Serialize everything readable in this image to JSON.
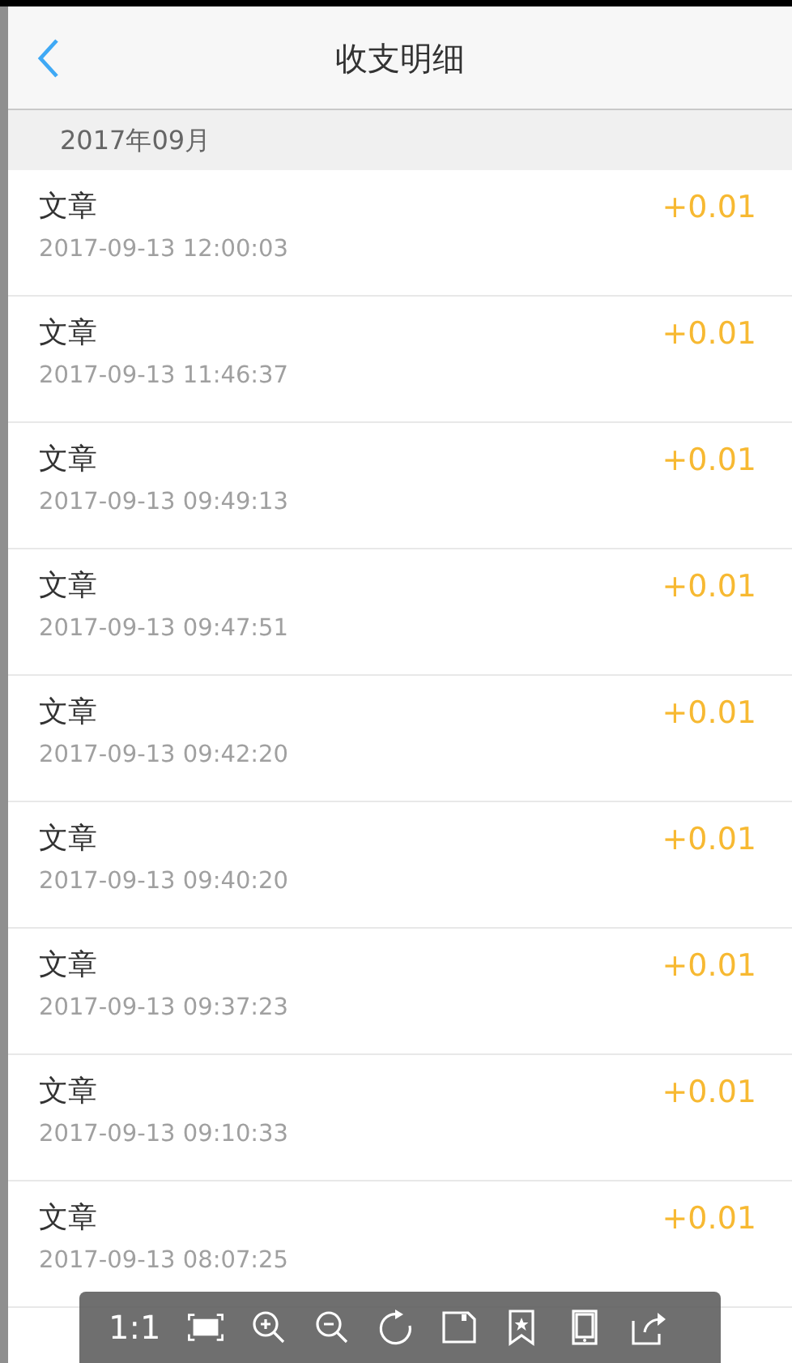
{
  "header": {
    "title": "收支明细"
  },
  "month": "2017年09月",
  "records": [
    {
      "title": "文章",
      "time": "2017-09-13 12:00:03",
      "amount": "+0.01"
    },
    {
      "title": "文章",
      "time": "2017-09-13 11:46:37",
      "amount": "+0.01"
    },
    {
      "title": "文章",
      "time": "2017-09-13 09:49:13",
      "amount": "+0.01"
    },
    {
      "title": "文章",
      "time": "2017-09-13 09:47:51",
      "amount": "+0.01"
    },
    {
      "title": "文章",
      "time": "2017-09-13 09:42:20",
      "amount": "+0.01"
    },
    {
      "title": "文章",
      "time": "2017-09-13 09:40:20",
      "amount": "+0.01"
    },
    {
      "title": "文章",
      "time": "2017-09-13 09:37:23",
      "amount": "+0.01"
    },
    {
      "title": "文章",
      "time": "2017-09-13 09:10:33",
      "amount": "+0.01"
    },
    {
      "title": "文章",
      "time": "2017-09-13 08:07:25",
      "amount": "+0.01"
    }
  ],
  "viewer_toolbar": {
    "ratio": "1:1"
  }
}
